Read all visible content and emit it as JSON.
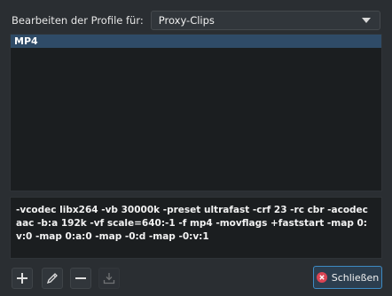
{
  "header": {
    "label": "Bearbeiten der Profile für:",
    "combo_value": "Proxy-Clips"
  },
  "profiles": {
    "items": [
      {
        "label": "MP4",
        "selected": true
      }
    ]
  },
  "command": {
    "text": "-vcodec libx264 -vb 30000k -preset ultrafast -crf 23 -rc cbr -acodec aac -b:a 192k -vf scale=640:-1 -f mp4 -movflags +faststart -map 0:v:0 -map 0:a:0 -map -0:d -map -0:v:1"
  },
  "toolbar": {
    "add_icon": "plus-icon",
    "edit_icon": "pencil-icon",
    "remove_icon": "minus-icon",
    "download_icon": "download-icon"
  },
  "close_button": {
    "label": "Schließen",
    "icon": "close-circle-icon",
    "accent": "#3d8bc4",
    "icon_color": "#da4453"
  }
}
